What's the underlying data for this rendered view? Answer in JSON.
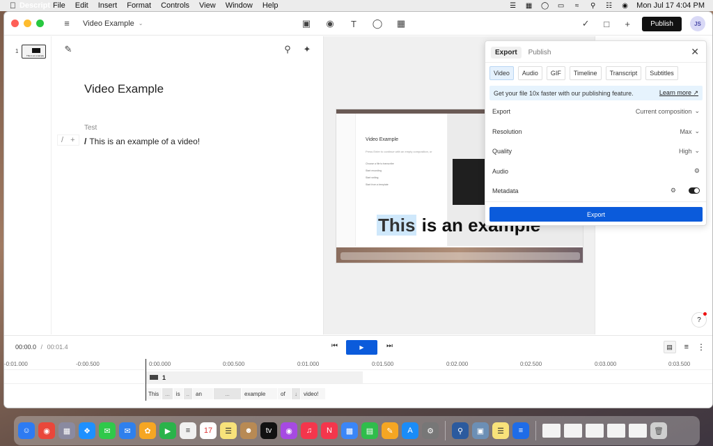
{
  "menubar": {
    "app": "Descript",
    "menus": [
      "File",
      "Edit",
      "Insert",
      "Format",
      "Controls",
      "View",
      "Window",
      "Help"
    ],
    "clock": "Mon Jul 17  4:04 PM"
  },
  "titlebar": {
    "doc_title": "Video Example",
    "publish_label": "Publish",
    "avatar_initials": "JS"
  },
  "thumbnails": {
    "scene_number": "1",
    "thumb_text": "This is an example"
  },
  "editor": {
    "heading": "Video Example",
    "speaker": "Test",
    "line_slash": "/",
    "line_text": "This is an example of a video!"
  },
  "preview": {
    "frame_title": "Video Example",
    "frame_sub": "Press Enter to continue with an empty composition, or",
    "frame_items": [
      "Choose a file to transcribe",
      "Start recording",
      "Start writing",
      "Start from a template"
    ],
    "caption_highlight": "This",
    "caption_rest": " is an example"
  },
  "export_panel": {
    "tabs": [
      "Export",
      "Publish"
    ],
    "formats": [
      "Video",
      "Audio",
      "GIF",
      "Timeline",
      "Transcript",
      "Subtitles"
    ],
    "banner_text": "Get your file 10x faster with our publishing feature.",
    "banner_link": "Learn more ↗",
    "settings": [
      {
        "label": "Export",
        "value": "Current composition"
      },
      {
        "label": "Resolution",
        "value": "Max"
      },
      {
        "label": "Quality",
        "value": "High"
      },
      {
        "label": "Audio",
        "value": ""
      },
      {
        "label": "Metadata",
        "value": ""
      }
    ],
    "export_button": "Export"
  },
  "transport": {
    "current_time": "00:00.0",
    "separator": "/",
    "duration": "00:01.4"
  },
  "timeline": {
    "ticks": [
      "-0:01.000",
      "-0:00.500",
      "0:00.000",
      "0:00.500",
      "0:01.000",
      "0:01.500",
      "0:02.000",
      "0:02.500",
      "0:03.000",
      "0:03.500"
    ],
    "scene_label": "1",
    "words": [
      "This",
      "...",
      "is",
      "..",
      "an",
      "...",
      "example",
      "of",
      "↓",
      "video!"
    ]
  },
  "help_label": "?"
}
